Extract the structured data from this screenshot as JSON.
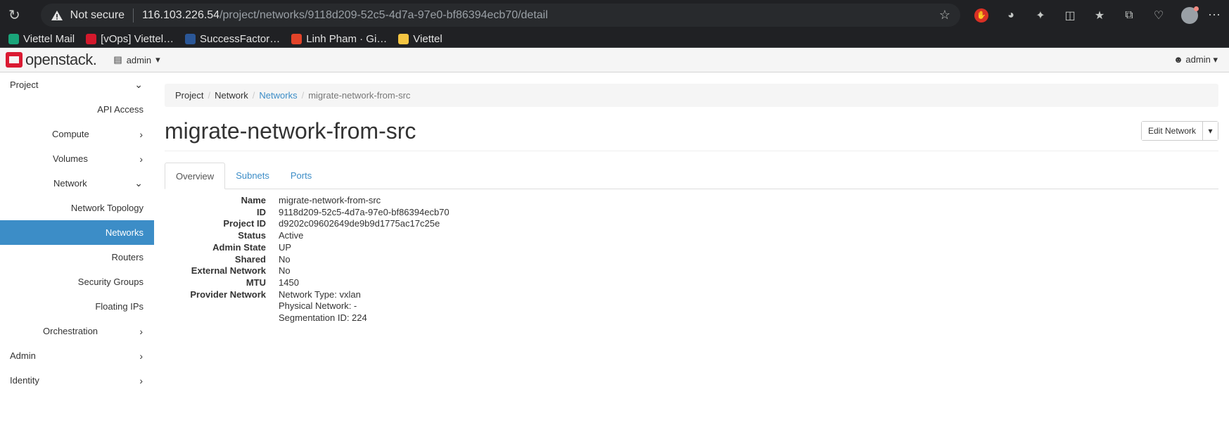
{
  "browser": {
    "security_label": "Not secure",
    "url_host": "116.103.226.54",
    "url_path": "/project/networks/9118d209-52c5-4d7a-97e0-bf86394ecb70/detail"
  },
  "bookmarks": [
    {
      "label": "Viettel Mail",
      "color": "#1aa57a"
    },
    {
      "label": "[vOps] Viettel…",
      "color": "#d4192c"
    },
    {
      "label": "SuccessFactor…",
      "color": "#2b5797"
    },
    {
      "label": "Linh Pham · Gi…",
      "color": "#e24329"
    },
    {
      "label": "Viettel",
      "color": "#f4c542"
    }
  ],
  "header": {
    "logo_text": "openstack.",
    "project_label": "admin",
    "user_label": "admin"
  },
  "sidebar": {
    "items": [
      {
        "label": "Project"
      },
      {
        "label": "API Access"
      },
      {
        "label": "Compute"
      },
      {
        "label": "Volumes"
      },
      {
        "label": "Network"
      },
      {
        "label": "Network Topology"
      },
      {
        "label": "Networks"
      },
      {
        "label": "Routers"
      },
      {
        "label": "Security Groups"
      },
      {
        "label": "Floating IPs"
      },
      {
        "label": "Orchestration"
      },
      {
        "label": "Admin"
      },
      {
        "label": "Identity"
      }
    ],
    "active_color": "#3c8dc7"
  },
  "breadcrumb": [
    "Project",
    "Network",
    "Networks",
    "migrate-network-from-src"
  ],
  "page_title": "migrate-network-from-src",
  "actions": {
    "edit_label": "Edit Network"
  },
  "tabs": [
    "Overview",
    "Subnets",
    "Ports"
  ],
  "details": [
    {
      "label": "Name",
      "value": "migrate-network-from-src"
    },
    {
      "label": "ID",
      "value": "9118d209-52c5-4d7a-97e0-bf86394ecb70"
    },
    {
      "label": "Project ID",
      "value": "d9202c09602649de9b9d1775ac17c25e"
    },
    {
      "label": "Status",
      "value": "Active"
    },
    {
      "label": "Admin State",
      "value": "UP"
    },
    {
      "label": "Shared",
      "value": "No"
    },
    {
      "label": "External Network",
      "value": "No"
    },
    {
      "label": "MTU",
      "value": "1450"
    },
    {
      "label": "Provider Network",
      "value": "Network Type: vxlan"
    },
    {
      "label": "",
      "value": "Physical Network: -"
    },
    {
      "label": "",
      "value": "Segmentation ID: 224"
    }
  ]
}
